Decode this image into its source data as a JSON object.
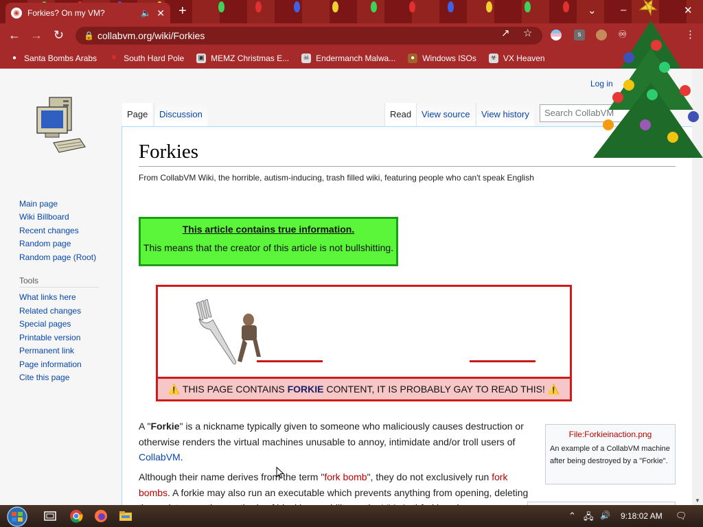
{
  "browser": {
    "tab_title": "Forkies? On my VM?",
    "url": "collabvm.org/wiki/Forkies",
    "bookmarks": [
      {
        "label": "Santa Bombs Arabs",
        "icon": "santa-icon"
      },
      {
        "label": "South Hard Pole",
        "icon": "snowflake-icon"
      },
      {
        "label": "MEMZ Christmas E...",
        "icon": "page-icon"
      },
      {
        "label": "Endermanch Malwa...",
        "icon": "skull-icon"
      },
      {
        "label": "Windows ISOs",
        "icon": "gingerbread-icon"
      },
      {
        "label": "VX Heaven",
        "icon": "biohazard-icon"
      }
    ]
  },
  "wiki": {
    "login": "Log in",
    "sidebar_nav": [
      "Main page",
      "Wiki Billboard",
      "Recent changes",
      "Random page",
      "Random page (Root)"
    ],
    "tools_heading": "Tools",
    "tools": [
      "What links here",
      "Related changes",
      "Special pages",
      "Printable version",
      "Permanent link",
      "Page information",
      "Cite this page"
    ],
    "tabs_left": [
      "Page",
      "Discussion"
    ],
    "tabs_right": [
      "Read",
      "View source",
      "View history"
    ],
    "search_placeholder": "Search CollabVM",
    "title": "Forkies",
    "tagline": "From CollabVM Wiki, the horrible, autism-inducing, trash filled wiki, featuring people who can't speak English",
    "notice": {
      "title": "This article contains true information.",
      "body": "This means that the creator of this article is not bullshitting."
    },
    "warning": {
      "pre": "THIS PAGE CONTAINS ",
      "bold": "FORKIE",
      "post": " CONTENT, IT IS PROBABLY GAY TO READ THIS!"
    },
    "para1": {
      "a": "A \"",
      "bold": "Forkie",
      "b": "\" is a nickname typically given to someone who maliciously causes destruction or otherwise renders the virtual machines unusable to annoy, intimidate and/or troll users of ",
      "link": "CollabVM",
      "c": "."
    },
    "para2": {
      "a": "Although their name derives from the term \"",
      "link1": "fork bomb",
      "b": "\", they do not exclusively run ",
      "link2": "fork bombs",
      "c": ". A forkie may also run an executable which prevents anything from opening, deleting the registry, or other methods of blocking usability on the VM. Anti-forkies also"
    },
    "figure": {
      "file": "File:Forkieinaction.png",
      "caption": "An example of a CollabVM machine after being destroyed by a \"Forkie\"."
    }
  },
  "taskbar": {
    "time": "9:18:02 AM"
  }
}
